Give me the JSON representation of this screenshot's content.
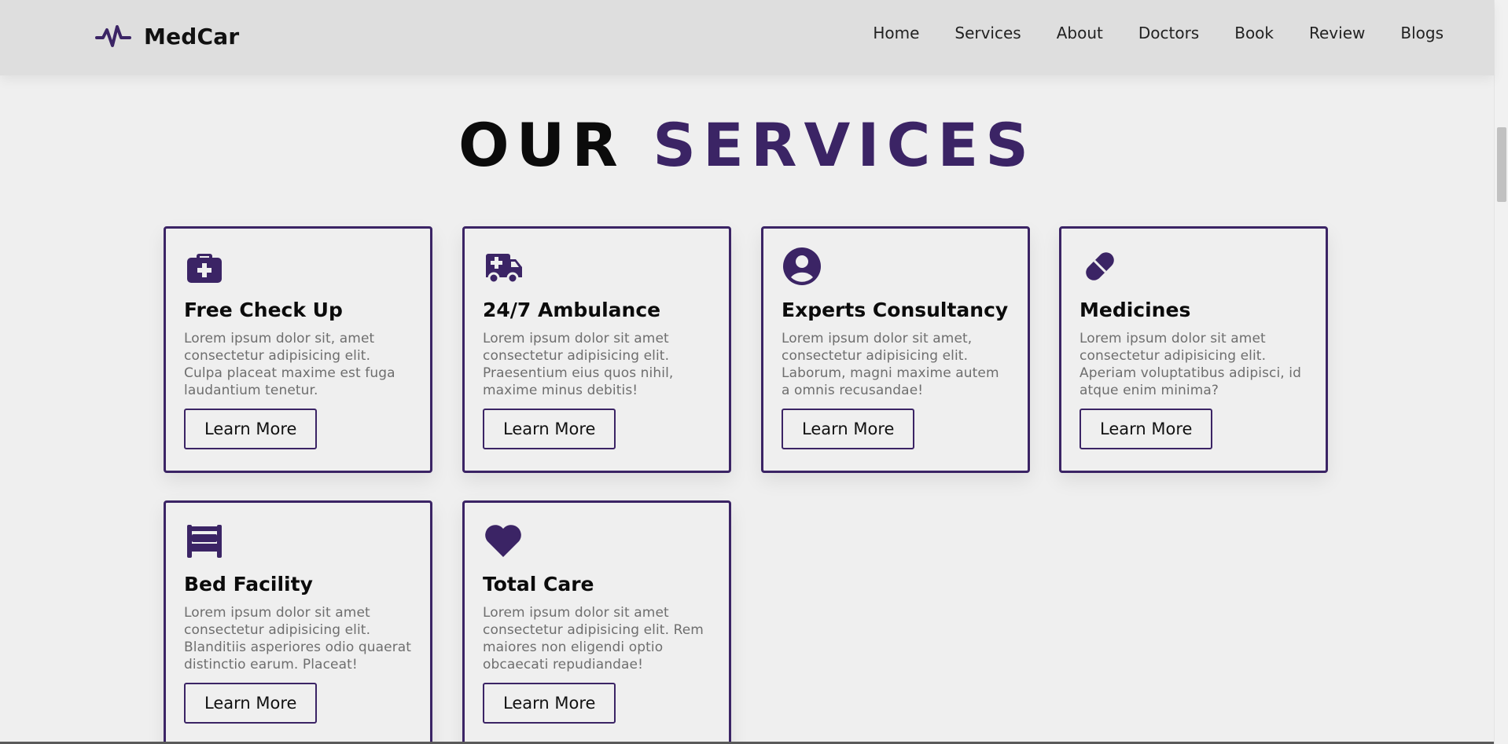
{
  "brand": {
    "name": "MedCar",
    "accent_color": "#3b2465"
  },
  "nav": {
    "items": [
      {
        "label": "Home"
      },
      {
        "label": "Services"
      },
      {
        "label": "About"
      },
      {
        "label": "Doctors"
      },
      {
        "label": "Book"
      },
      {
        "label": "Review"
      },
      {
        "label": "Blogs"
      }
    ]
  },
  "heading": {
    "part1": "OUR",
    "part2": "SERVICES"
  },
  "services": [
    {
      "icon": "medical-kit-icon",
      "title": "Free Check Up",
      "desc": "Lorem ipsum dolor sit, amet consectetur adipisicing elit. Culpa placeat maxime est fuga laudantium tenetur.",
      "button": "Learn More"
    },
    {
      "icon": "ambulance-icon",
      "title": "24/7 Ambulance",
      "desc": "Lorem ipsum dolor sit amet consectetur adipisicing elit. Praesentium eius quos nihil, maxime minus debitis!",
      "button": "Learn More"
    },
    {
      "icon": "user-doctor-icon",
      "title": "Experts Consultancy",
      "desc": "Lorem ipsum dolor sit amet, consectetur adipisicing elit. Laborum, magni maxime autem a omnis recusandae!",
      "button": "Learn More"
    },
    {
      "icon": "pill-icon",
      "title": "Medicines",
      "desc": "Lorem ipsum dolor sit amet consectetur adipisicing elit. Aperiam voluptatibus adipisci, id atque enim minima?",
      "button": "Learn More"
    },
    {
      "icon": "bed-icon",
      "title": "Bed Facility",
      "desc": "Lorem ipsum dolor sit amet consectetur adipisicing elit. Blanditiis asperiores odio quaerat distinctio earum. Placeat!",
      "button": "Learn More"
    },
    {
      "icon": "heart-icon",
      "title": "Total Care",
      "desc": "Lorem ipsum dolor sit amet consectetur adipisicing elit. Rem maiores non eligendi optio obcaecati repudiandae!",
      "button": "Learn More"
    }
  ]
}
